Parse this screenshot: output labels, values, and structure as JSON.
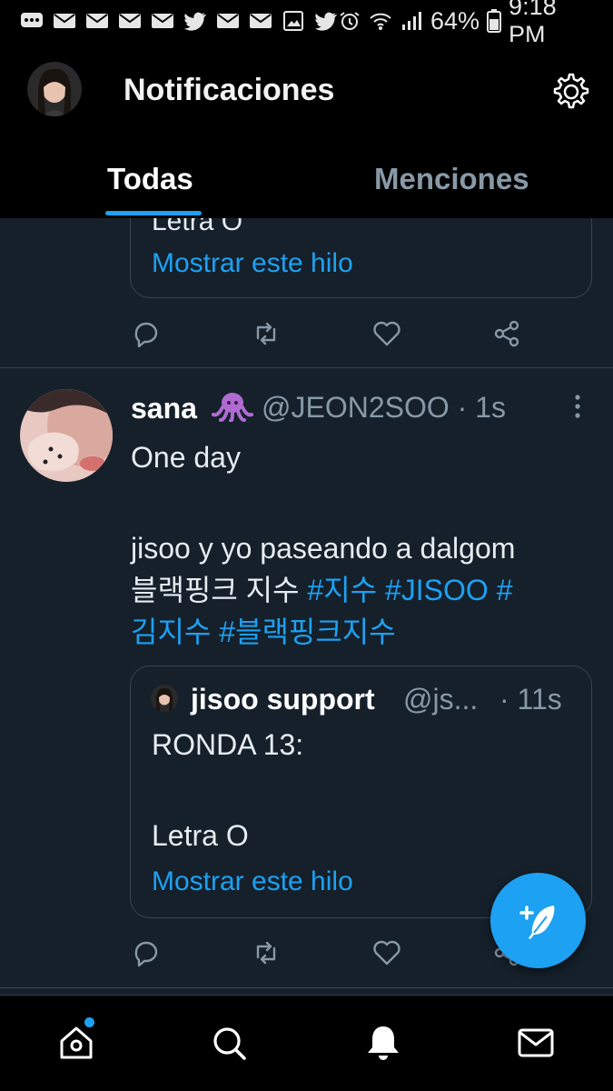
{
  "status_bar": {
    "left_icons": [
      "chat-bubble-icon",
      "mail-icon",
      "mail-icon",
      "mail-icon",
      "mail-icon",
      "twitter-bird-icon",
      "mail-icon",
      "mail-icon",
      "gallery-icon",
      "twitter-bird-icon"
    ],
    "battery_percent": "64%",
    "time": "9:18 PM"
  },
  "header": {
    "title": "Notificaciones",
    "tabs": [
      {
        "label": "Todas",
        "active": true
      },
      {
        "label": "Menciones",
        "active": false
      }
    ]
  },
  "feed": {
    "previous_quote": {
      "partial_text": "Letra O",
      "show_thread": "Mostrar este hilo"
    },
    "tweet": {
      "name": "sana",
      "emoji": "🐙",
      "handle_time": "@JEON2SOO · 1s",
      "lines": [
        {
          "text": "One day"
        },
        {
          "text": ""
        },
        {
          "text": "jisoo y yo paseando a dalgom"
        }
      ],
      "korean_prefix": "블랙핑크 지수 ",
      "hashtags_line1": "#지수 #JISOO #",
      "hashtags_line2": "김지수 #블랙핑크지수",
      "quote": {
        "name": "jisoo support",
        "handle": "@js...",
        "time": "· 11s",
        "text_line1": "RONDA 13:",
        "text_line2": "Letra O",
        "show_thread": "Mostrar este hilo"
      }
    }
  },
  "bottom_nav": {
    "items": [
      "home-icon",
      "search-icon",
      "notifications-icon",
      "messages-icon"
    ],
    "active": "notifications-icon"
  },
  "colors": {
    "background": "#15202b",
    "accent": "#1da1f2",
    "muted": "#8899a6",
    "border": "#38444d"
  }
}
